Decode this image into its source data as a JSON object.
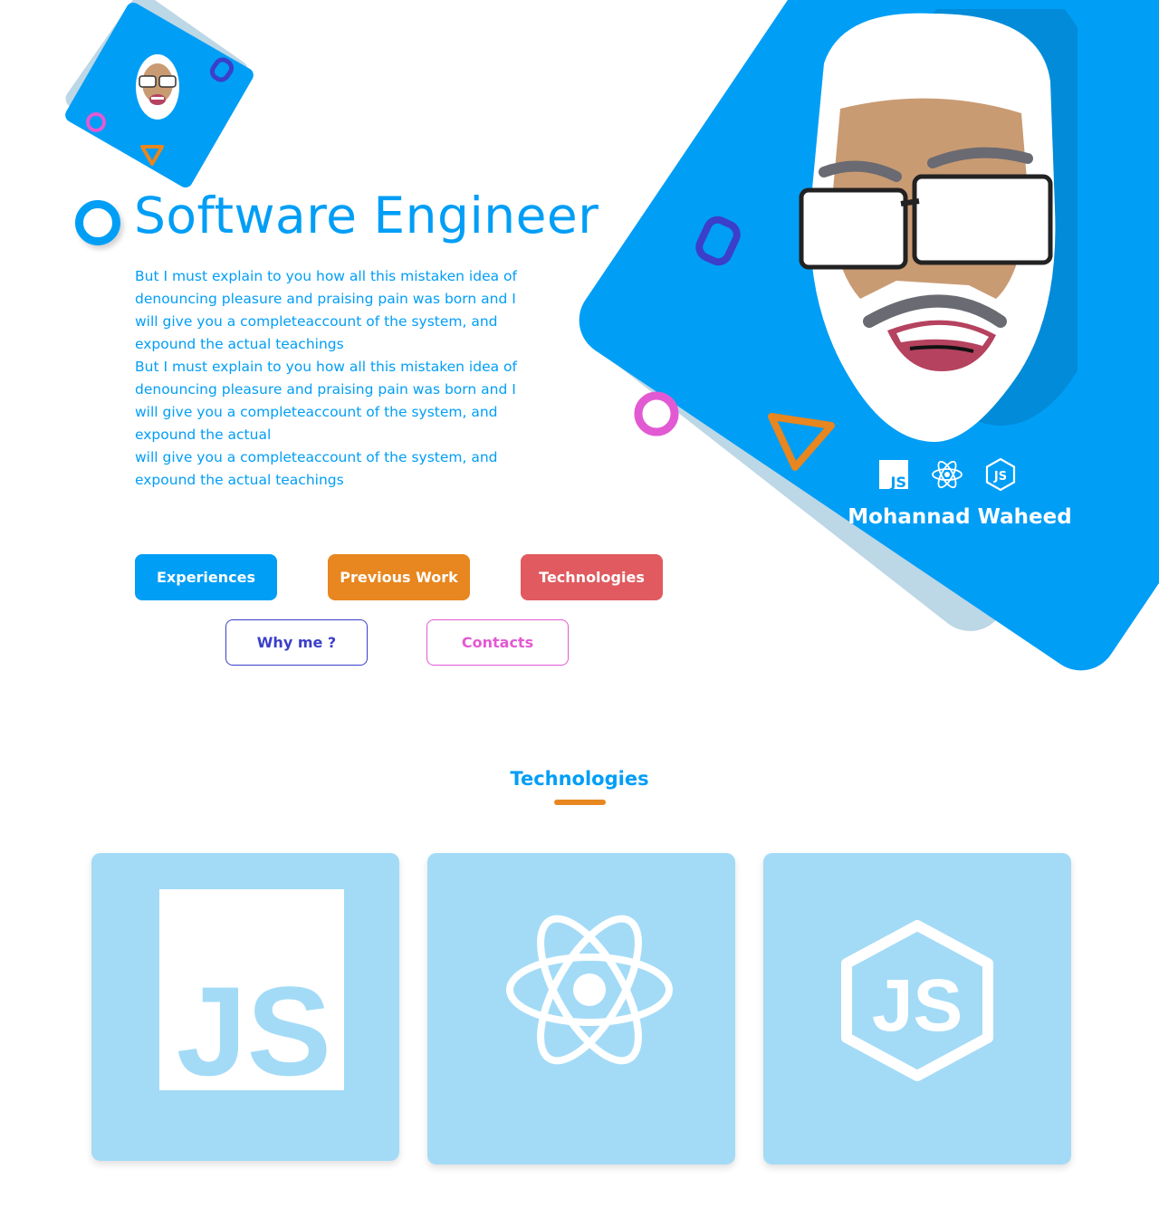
{
  "header": {
    "title": "Software Engineer",
    "bio": [
      "But I must explain to you how all this mistaken idea of",
      "denouncing pleasure and praising pain was born and I",
      "will give you a completeaccount of the system, and",
      "expound the actual teachings",
      "But I must explain to you how all this mistaken idea of",
      "denouncing pleasure and praising pain was born and I",
      "will give you a completeaccount of the system, and",
      "expound the actual",
      "will give you a completeaccount of the system, and",
      "expound the actual teachings"
    ]
  },
  "buttons": {
    "experiences": "Experiences",
    "previous_work": "Previous Work",
    "technologies": "Technologies",
    "why_me": "Why me  ?",
    "contacts": "Contacts"
  },
  "profile": {
    "name": "Mohannad Waheed",
    "icons": [
      "javascript-icon",
      "react-icon",
      "nodejs-icon"
    ]
  },
  "technologies_section": {
    "title": "Technologies",
    "cards": [
      "javascript-icon",
      "react-icon",
      "nodejs-icon"
    ]
  },
  "colors": {
    "primary": "#019ef6",
    "orange": "#e8861f",
    "red": "#e05a5f",
    "indigo": "#3b3fc9",
    "pink": "#e25ad3",
    "card_bg": "#a3dbf7"
  }
}
